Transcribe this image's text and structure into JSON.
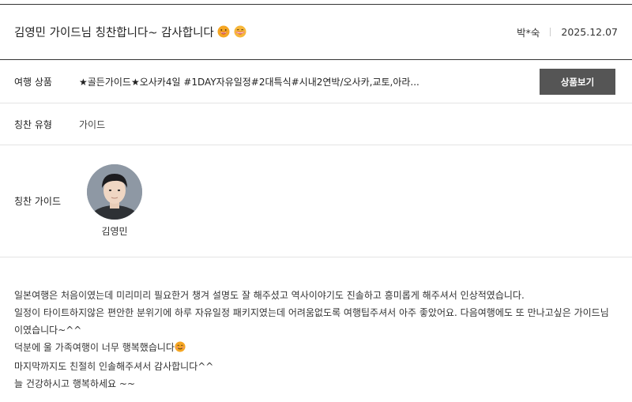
{
  "review": {
    "title": "김영민 가이드님 칭찬합니다~ 감사합니다",
    "title_emojis": [
      "grinning-face-icon",
      "grinning-face-icon"
    ],
    "author": "박*숙",
    "date": "2025.12.07"
  },
  "rows": {
    "product": {
      "label": "여행 상품",
      "value": "★골든가이드★오사카4일 #1DAY자유일정#2대특식#시내2연박/오사카,교토,아라...",
      "button_label": "상품보기"
    },
    "type": {
      "label": "칭찬 유형",
      "value": "가이드"
    },
    "guide": {
      "label": "칭찬 가이드",
      "name": "김영민"
    }
  },
  "body": {
    "lines": [
      "일본여행은 처음이였는데 미리미리 필요한거 챙겨 설명도 잘 해주셨고 역사이야기도 진솔하고 흥미롭게 해주셔서 인상적였습니다.",
      "일정이 타이트하지않은 편안한 분위기에 하루 자유일정 패키지였는데 어려움없도록 여행팁주셔서 아주 좋았어요. 다음여행에도 또 만나고싶은 가이드님이였습니다~^^",
      "덕분에 울 가족여행이 너무 행복했습니다",
      "마지막까지도 친절히 인솔해주셔서 감사합니다^^",
      "늘 건강하시고 행복하세요 ~~"
    ]
  },
  "colors": {
    "button_bg": "#555555",
    "header_rule": "#333333",
    "divider": "#e4e4e4"
  }
}
